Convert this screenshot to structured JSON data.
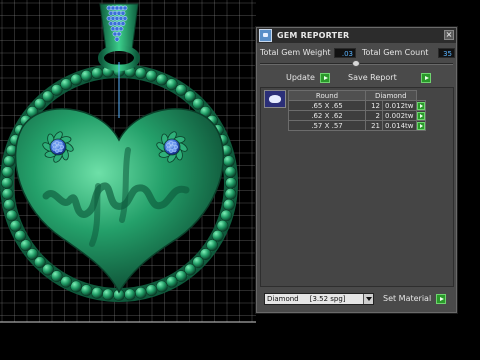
{
  "panel": {
    "title": "GEM REPORTER",
    "close_label": "×",
    "total_weight_label": "Total Gem Weight",
    "total_weight_value": ".03",
    "total_count_label": "Total Gem Count",
    "total_count_value": "35",
    "update_label": "Update",
    "save_report_label": "Save Report",
    "table": {
      "headers": [
        "Round",
        "Diamond"
      ],
      "rows": [
        {
          "size": ".65 X .65",
          "count": "12",
          "weight": "0.012tw"
        },
        {
          "size": ".62 X .62",
          "count": "2",
          "weight": "0.002tw"
        },
        {
          "size": ".57 X .57",
          "count": "21",
          "weight": "0.014tw"
        }
      ]
    },
    "material_value": "Diamond     [3.52 spg]",
    "set_material_label": "Set Material"
  },
  "colors": {
    "panel_bg": "#4a4a4a",
    "titlebar_bg": "#2c2c2c",
    "value_text": "#5ab4ff",
    "action_green": "#2a9a2a",
    "gold_metal": "#1f9a6a",
    "gem_blue": "#3a6fd8",
    "grid_line": "#cfcfcf"
  },
  "icons": {
    "app": "gem-reporter-app-icon",
    "close": "close-icon",
    "action": "green-play-arrow-icon",
    "gem": "round-gem-thumbnail-icon",
    "dropdown": "chevron-down-icon"
  }
}
